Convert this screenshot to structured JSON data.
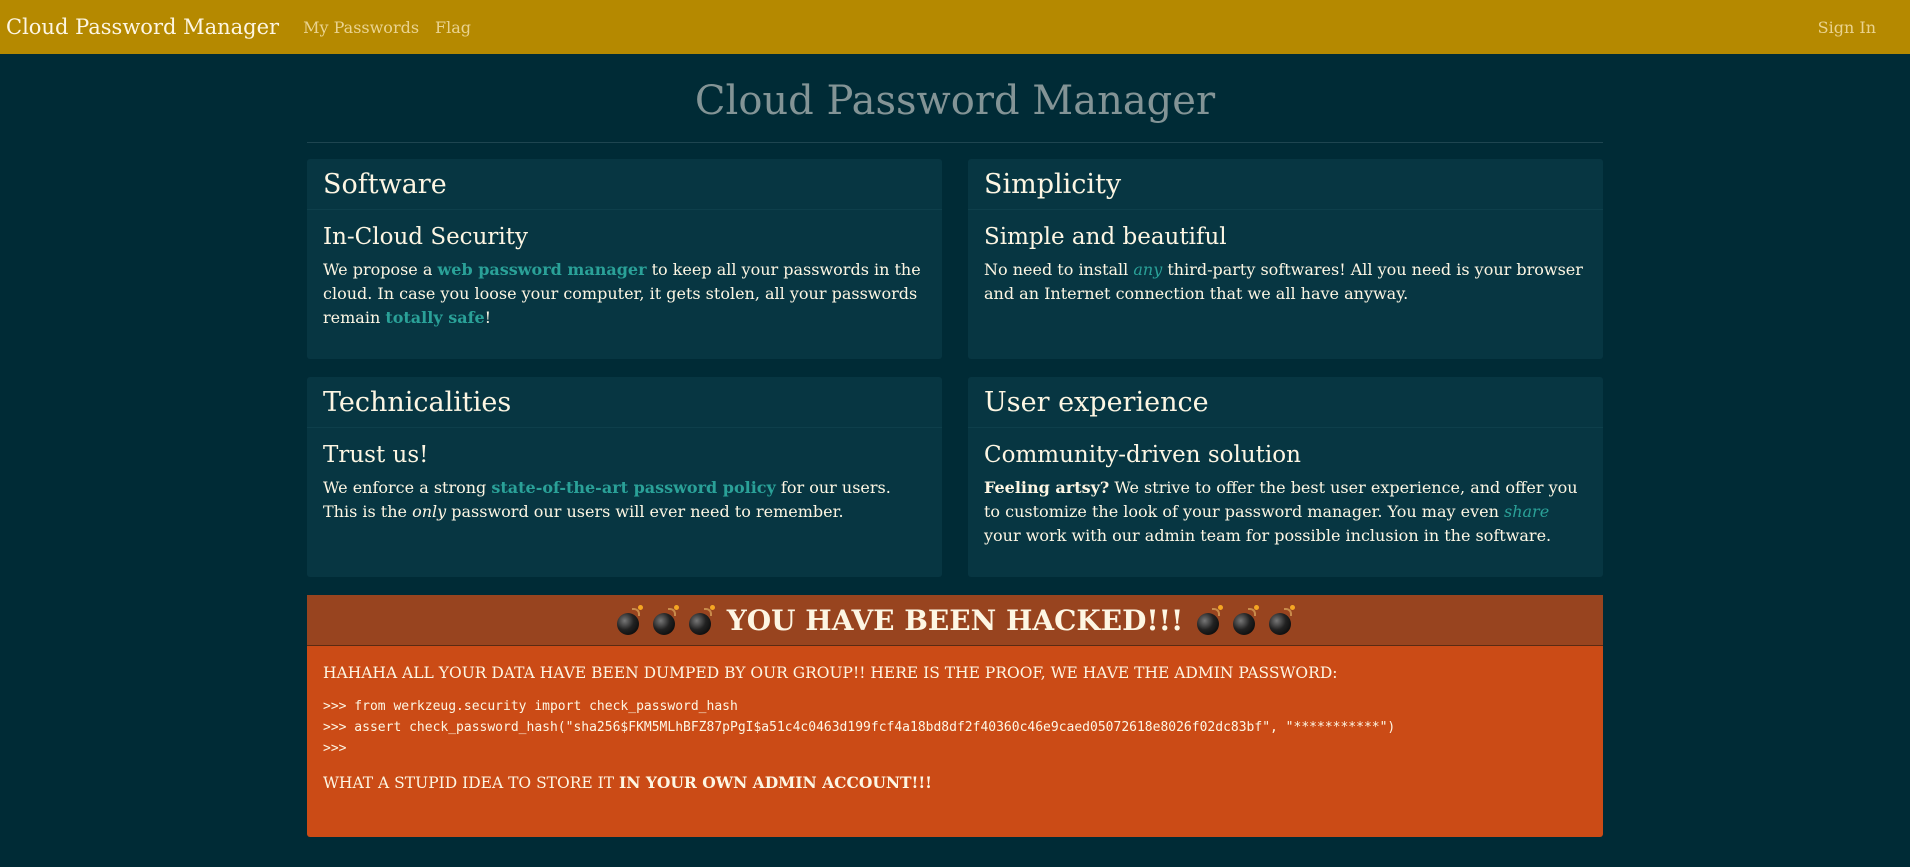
{
  "navbar": {
    "brand": "Cloud Password Manager",
    "links": [
      "My Passwords",
      "Flag"
    ],
    "sign_in": "Sign In"
  },
  "page_title": "Cloud Password Manager",
  "panels": [
    {
      "heading": "Software",
      "subheading": "In-Cloud Security",
      "text": [
        "We propose a ",
        "web password manager",
        " to keep all your passwords in the cloud. In case you loose your computer, it gets stolen, all your passwords remain ",
        "totally safe",
        "!"
      ]
    },
    {
      "heading": "Simplicity",
      "subheading": "Simple and beautiful",
      "text": [
        "No need to install ",
        "any",
        " third-party softwares! All you need is your browser and an Internet connection that we all have anyway."
      ]
    },
    {
      "heading": "Technicalities",
      "subheading": "Trust us!",
      "text": [
        "We enforce a strong ",
        "state-of-the-art password policy",
        " for our users. This is the ",
        "only",
        " password our users will ever need to remember."
      ]
    },
    {
      "heading": "User experience",
      "subheading": "Community-driven solution",
      "text": [
        "Feeling artsy?",
        " We strive to offer the best user experience, and offer you to customize the look of your password manager. You may even ",
        "share",
        " your work with our admin team for possible inclusion in the software."
      ]
    }
  ],
  "hacked": {
    "title": "YOU HAVE BEEN HACKED!!!",
    "message": "HAHAHA ALL YOUR DATA HAVE BEEN DUMPED BY OUR GROUP!! HERE IS THE PROOF, WE HAVE THE ADMIN PASSWORD:",
    "code_lines": [
      ">>> from werkzeug.security import check_password_hash",
      ">>> assert check_password_hash(\"sha256$FKM5MLhBFZ87pPgI$a51c4c0463d199fcf4a18bd8df2f40360c46e9caed05072618e8026f02dc83bf\", \"***********\")",
      ">>>"
    ],
    "footer_prefix": "WHAT A STUPID IDEA TO STORE IT ",
    "footer_bold": "IN YOUR OWN ADMIN ACCOUNT!!!"
  },
  "colors": {
    "navbar": "#b58900",
    "background": "#002b36",
    "panel": "#073642",
    "accent": "#2aa198",
    "hacked": "#cb4b16",
    "hacked_head": "#98441f"
  },
  "icons": [
    "bomb-icon"
  ]
}
